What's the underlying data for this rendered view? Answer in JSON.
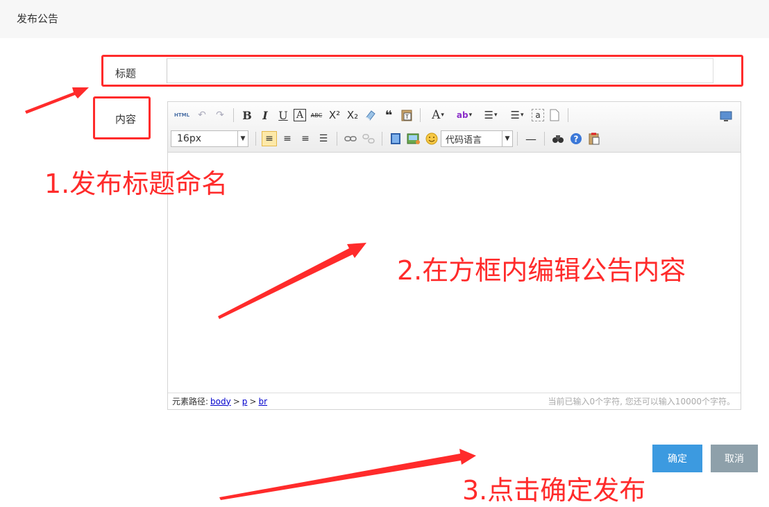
{
  "page": {
    "title": "发布公告"
  },
  "form": {
    "title_label": "标题",
    "title_value": "",
    "content_label": "内容"
  },
  "editor": {
    "toolbar_row1": [
      "html-icon",
      "undo-icon",
      "redo-icon",
      "bold-icon",
      "italic-icon",
      "underline-icon",
      "font-border-icon",
      "strikethrough-icon",
      "superscript-icon",
      "subscript-icon",
      "eraser-icon",
      "blockquote-icon",
      "paste-plain-icon",
      "font-color-icon",
      "back-color-icon",
      "ordered-list-icon",
      "unordered-list-icon",
      "select-all-icon",
      "clear-doc-icon",
      "preview-icon"
    ],
    "html_glyph": "HTML",
    "bold_glyph": "B",
    "italic_glyph": "I",
    "underline_glyph": "U",
    "font_border_glyph": "A",
    "strike_glyph": "ABC",
    "font_color_glyph": "A",
    "back_color_glyph": "ab",
    "select_all_glyph": "a",
    "font_size": "16px",
    "code_language": "代码语言",
    "status_path_label": "元素路径:",
    "status_path": [
      "body",
      "p",
      "br"
    ],
    "path_separator": ">",
    "char_count_text": "当前已输入0个字符, 您还可以输入10000个字符。"
  },
  "actions": {
    "confirm_label": "确定",
    "cancel_label": "取消"
  },
  "annotations": {
    "step1": "1.发布标题命名",
    "step2": "2.在方框内编辑公告内容",
    "step3": "3.点击确定发布",
    "color": "#ff2b2b"
  },
  "colors": {
    "primary_button": "#3c9ae0",
    "secondary_button": "#8ea0aa",
    "link": "#0000cc"
  }
}
